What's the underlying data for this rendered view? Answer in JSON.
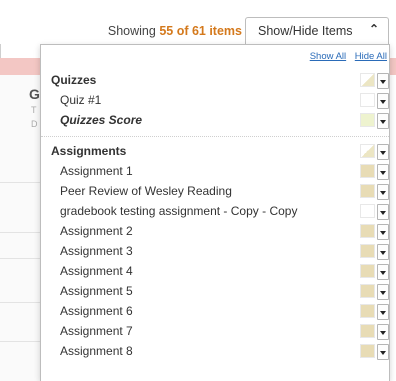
{
  "header": {
    "showing_prefix": "Showing",
    "showing_count": "55 of 61 items",
    "button_label": "Show/Hide Items"
  },
  "background": {
    "col_initial": "G",
    "col_sub1": "T",
    "col_sub2": "D"
  },
  "panel": {
    "show_all": "Show All",
    "hide_all": "Hide All",
    "groups": [
      {
        "label": "Quizzes",
        "swatch": "half",
        "items": [
          {
            "label": "Quiz #1",
            "color": "#ffffff",
            "italic": false
          },
          {
            "label": "Quizzes Score",
            "color": "#eef3cf",
            "italic": true
          }
        ]
      },
      {
        "label": "Assignments",
        "swatch": "half",
        "items": [
          {
            "label": "Assignment 1",
            "color": "#e8dcb5",
            "italic": false
          },
          {
            "label": "Peer Review of Wesley Reading",
            "color": "#e8dcb5",
            "italic": false
          },
          {
            "label": "gradebook testing assignment - Copy - Copy",
            "color": "#ffffff",
            "italic": false
          },
          {
            "label": "Assignment 2",
            "color": "#e8dcb5",
            "italic": false
          },
          {
            "label": "Assignment 3",
            "color": "#e8dcb5",
            "italic": false
          },
          {
            "label": "Assignment 4",
            "color": "#e8dcb5",
            "italic": false
          },
          {
            "label": "Assignment 5",
            "color": "#e8dcb5",
            "italic": false
          },
          {
            "label": "Assignment 6",
            "color": "#e8dcb5",
            "italic": false
          },
          {
            "label": "Assignment 7",
            "color": "#e8dcb5",
            "italic": false
          },
          {
            "label": "Assignment 8",
            "color": "#e8dcb5",
            "italic": false
          }
        ]
      }
    ]
  },
  "colors": {
    "accent_count": "#d4791c",
    "link": "#2a6bb8",
    "header_bg": "#f3c7c4"
  }
}
